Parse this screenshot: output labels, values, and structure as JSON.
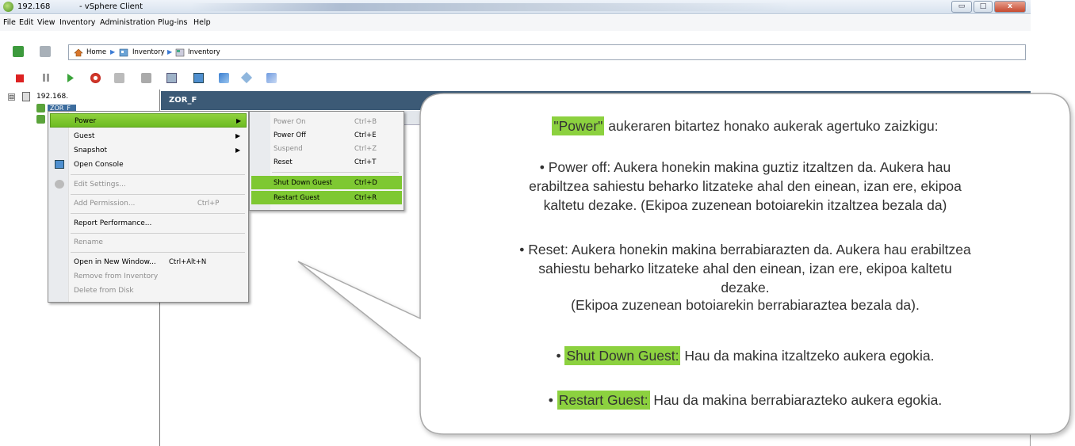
{
  "window": {
    "host_ip": "192.168",
    "app_title": "- vSphere Client",
    "minimize": "▭",
    "maximize": "□",
    "close": "x"
  },
  "menubar": {
    "items": [
      "File",
      "Edit",
      "View",
      "Inventory",
      "Administration",
      "Plug-ins",
      "Help"
    ]
  },
  "navbar": {
    "crumb_home": "Home",
    "crumb_inventory_1": "Inventory",
    "crumb_inventory_2": "Inventory"
  },
  "tree": {
    "expander": "⊟",
    "host": "192.168.",
    "vm_selected": "ZOR_F"
  },
  "panel": {
    "title": "ZOR_F"
  },
  "context_menu": {
    "power": "Power",
    "guest": "Guest",
    "snapshot": "Snapshot",
    "open_console": "Open Console",
    "edit_settings": "Edit Settings...",
    "add_permission": "Add Permission...",
    "add_permission_shortcut": "Ctrl+P",
    "report_performance": "Report Performance...",
    "rename": "Rename",
    "open_new_window": "Open in New Window...",
    "open_new_window_shortcut": "Ctrl+Alt+N",
    "remove_inventory": "Remove from Inventory",
    "delete_disk": "Delete from Disk",
    "arrow": "▶"
  },
  "power_submenu": {
    "power_on": "Power On",
    "power_on_sc": "Ctrl+B",
    "power_off": "Power Off",
    "power_off_sc": "Ctrl+E",
    "suspend": "Suspend",
    "suspend_sc": "Ctrl+Z",
    "reset": "Reset",
    "reset_sc": "Ctrl+T",
    "shutdown": "Shut Down Guest",
    "shutdown_sc": "Ctrl+D",
    "restart": "Restart Guest",
    "restart_sc": "Ctrl+R"
  },
  "callout": {
    "intro_term": "\"Power\"",
    "intro_rest": " aukeraren bitartez honako aukerak agertuko zaizkigu:",
    "poweroff_line1": "• Power off: Aukera honekin makina guztiz itzaltzen da. Aukera hau",
    "poweroff_line2": "erabiltzea sahiestu beharko litzateke ahal den einean, izan ere, ekipoa",
    "poweroff_line3": "kaltetu dezake. (Ekipoa zuzenean botoiarekin itzaltzea bezala da)",
    "reset_line1": "• Reset: Aukera honekin makina berrabiarazten da. Aukera hau erabiltzea",
    "reset_line2": "sahiestu beharko litzateke ahal den einean, izan ere, ekipoa kaltetu",
    "reset_line3": "dezake.",
    "reset_line4": "(Ekipoa zuzenean botoiarekin berrabiaraztea bezala da).",
    "shutdown_bullet": "• ",
    "shutdown_term": "Shut Down Guest:",
    "shutdown_rest": " Hau da makina itzaltzeko aukera egokia.",
    "restart_bullet": "• ",
    "restart_term": "Restart Guest:",
    "restart_rest": " Hau da makina berrabiarazteko aukera egokia."
  },
  "colors": {
    "highlight": "#8cd13f",
    "panel_header": "#3c5a76",
    "selection": "#3d6d9e"
  }
}
